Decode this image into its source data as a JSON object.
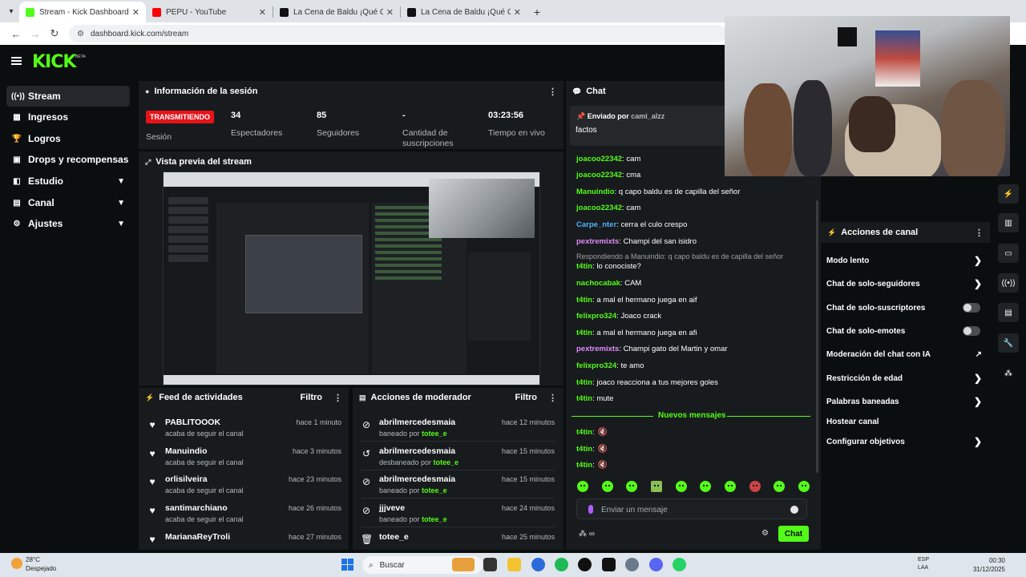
{
  "browser": {
    "tabs": [
      {
        "title": "Stream - Kick Dashboard",
        "active": true,
        "color": "#53fc18"
      },
      {
        "title": "PEPU - YouTube",
        "active": false,
        "color": "#ff0000"
      },
      {
        "title": "La Cena de Baldu ¡Qué Come",
        "active": false,
        "color": "#111111"
      },
      {
        "title": "La Cena de Baldu ¡Qué Come",
        "active": false,
        "color": "#111111"
      }
    ],
    "url": "dashboard.kick.com/stream"
  },
  "header": {
    "logo": "KICK",
    "beta": "BETA"
  },
  "sidebar": {
    "items": [
      {
        "label": "Stream",
        "icon": "broadcast-icon",
        "active": true
      },
      {
        "label": "Ingresos",
        "icon": "revenue-icon"
      },
      {
        "label": "Logros",
        "icon": "trophy-icon"
      },
      {
        "label": "Drops y recompensas",
        "icon": "gift-icon"
      },
      {
        "label": "Estudio",
        "icon": "studio-icon",
        "expandable": true
      },
      {
        "label": "Canal",
        "icon": "channel-icon",
        "expandable": true
      },
      {
        "label": "Ajustes",
        "icon": "gear-icon",
        "expandable": true
      }
    ]
  },
  "session": {
    "title": "Información de la sesión",
    "badge": "TRANSMITIENDO",
    "badge_label": "Sesión",
    "stats": [
      {
        "value": "34",
        "label": "Espectadores"
      },
      {
        "value": "85",
        "label": "Seguidores"
      },
      {
        "value": "-",
        "label": "Cantidad de suscripciones"
      },
      {
        "value": "03:23:56",
        "label": "Tiempo en vivo"
      }
    ]
  },
  "preview": {
    "title": "Vista previa del stream"
  },
  "activity": {
    "title": "Feed de actividades",
    "filter": "Filtro",
    "items": [
      {
        "name": "PABLITOOOK",
        "sub": "acaba de seguir el canal",
        "time": "hace 1 minuto"
      },
      {
        "name": "Manuindio",
        "sub": "acaba de seguir el canal",
        "time": "hace 3 minutos"
      },
      {
        "name": "orlisilveira",
        "sub": "acaba de seguir el canal",
        "time": "hace 23 minutos"
      },
      {
        "name": "santimarchiano",
        "sub": "acaba de seguir el canal",
        "time": "hace 26 minutos"
      },
      {
        "name": "MarianaReyTroli",
        "sub": "",
        "time": "hace 27 minutos"
      }
    ]
  },
  "modactions": {
    "title": "Acciones de moderador",
    "filter": "Filtro",
    "items": [
      {
        "name": "abrilmercedesmaia",
        "action": "baneado por",
        "by": "totee_e",
        "time": "hace 12 minutos",
        "icon": "ban-icon"
      },
      {
        "name": "abrilmercedesmaia",
        "action": "desbaneado por",
        "by": "totee_e",
        "time": "hace 15 minutos",
        "icon": "undo-icon"
      },
      {
        "name": "abrilmercedesmaia",
        "action": "baneado por",
        "by": "totee_e",
        "time": "hace 15 minutos",
        "icon": "ban-icon"
      },
      {
        "name": "jjjveve",
        "action": "baneado por",
        "by": "totee_e",
        "time": "hace 24 minutos",
        "icon": "ban-icon"
      },
      {
        "name": "totee_e",
        "action": "",
        "by": "",
        "time": "hace 25 minutos",
        "icon": "trash-icon"
      }
    ]
  },
  "chat": {
    "title": "Chat",
    "pinned": {
      "prefix": "Enviado por",
      "user": "cami_alzz",
      "message": "factos"
    },
    "messages": [
      {
        "user": "joacoo22342",
        "color": "#53fc18",
        "text": "cam"
      },
      {
        "user": "joacoo22342",
        "color": "#53fc18",
        "text": "cma"
      },
      {
        "user": "Manuindio",
        "color": "#53fc18",
        "text": "q capo baldu es de capilla del señor"
      },
      {
        "user": "joacoo22342",
        "color": "#53fc18",
        "text": "cam"
      },
      {
        "user": "Carpe_nter",
        "color": "#4fb3ff",
        "text": "cerra el culo crespo"
      },
      {
        "user": "pextremixts",
        "color": "#e08cff",
        "text": "Champi del san isidro"
      },
      {
        "reply": "Respondiendo a Manuindio: q capo baldu es de capilla del señor"
      },
      {
        "user": "t4tin",
        "color": "#53fc18",
        "text": "lo conociste?"
      },
      {
        "user": "nachocabak",
        "color": "#53fc18",
        "text": "CAM"
      },
      {
        "user": "t4tin",
        "color": "#53fc18",
        "text": "a mal el hermano juega en aif"
      },
      {
        "user": "felixpro324",
        "color": "#53fc18",
        "text": "Joaco crack"
      },
      {
        "user": "t4tin",
        "color": "#53fc18",
        "text": "a mal el hermano juega en afi"
      },
      {
        "user": "pextremixts",
        "color": "#e08cff",
        "text": "Champi gato del Martin y omar"
      },
      {
        "user": "felixpro324",
        "color": "#53fc18",
        "text": "te amo"
      },
      {
        "user": "t4tin",
        "color": "#53fc18",
        "text": "joaco reacciona a tus mejores goles"
      },
      {
        "user": "t4tin",
        "color": "#53fc18",
        "text": "mute"
      }
    ],
    "new_messages": "Nuevos mensajes",
    "after_new": [
      {
        "user": "t4tin",
        "color": "#53fc18"
      },
      {
        "user": "t4tin",
        "color": "#53fc18"
      },
      {
        "user": "t4tin",
        "color": "#53fc18"
      }
    ],
    "input_placeholder": "Enviar un mensaje",
    "send_label": "Chat"
  },
  "channel_actions": {
    "title": "Acciones de canal",
    "items": [
      {
        "label": "Modo lento",
        "kind": "arrow"
      },
      {
        "label": "Chat de solo-seguidores",
        "kind": "arrow"
      },
      {
        "label": "Chat de solo-suscriptores",
        "kind": "toggle"
      },
      {
        "label": "Chat de solo-emotes",
        "kind": "toggle"
      },
      {
        "label": "Moderación del chat con IA",
        "kind": "external"
      },
      {
        "label": "Restricción de edad",
        "kind": "arrow"
      },
      {
        "label": "Palabras baneadas",
        "kind": "arrow"
      },
      {
        "label": "Hostear canal",
        "kind": "none"
      },
      {
        "label": "Configurar objetivos",
        "kind": "arrow"
      }
    ]
  },
  "taskbar": {
    "weather_temp": "28°C",
    "weather_desc": "Despejado",
    "search": "Buscar",
    "lang1": "ESP",
    "lang2": "LAA",
    "time": "00:30",
    "date": "31/12/2025"
  }
}
